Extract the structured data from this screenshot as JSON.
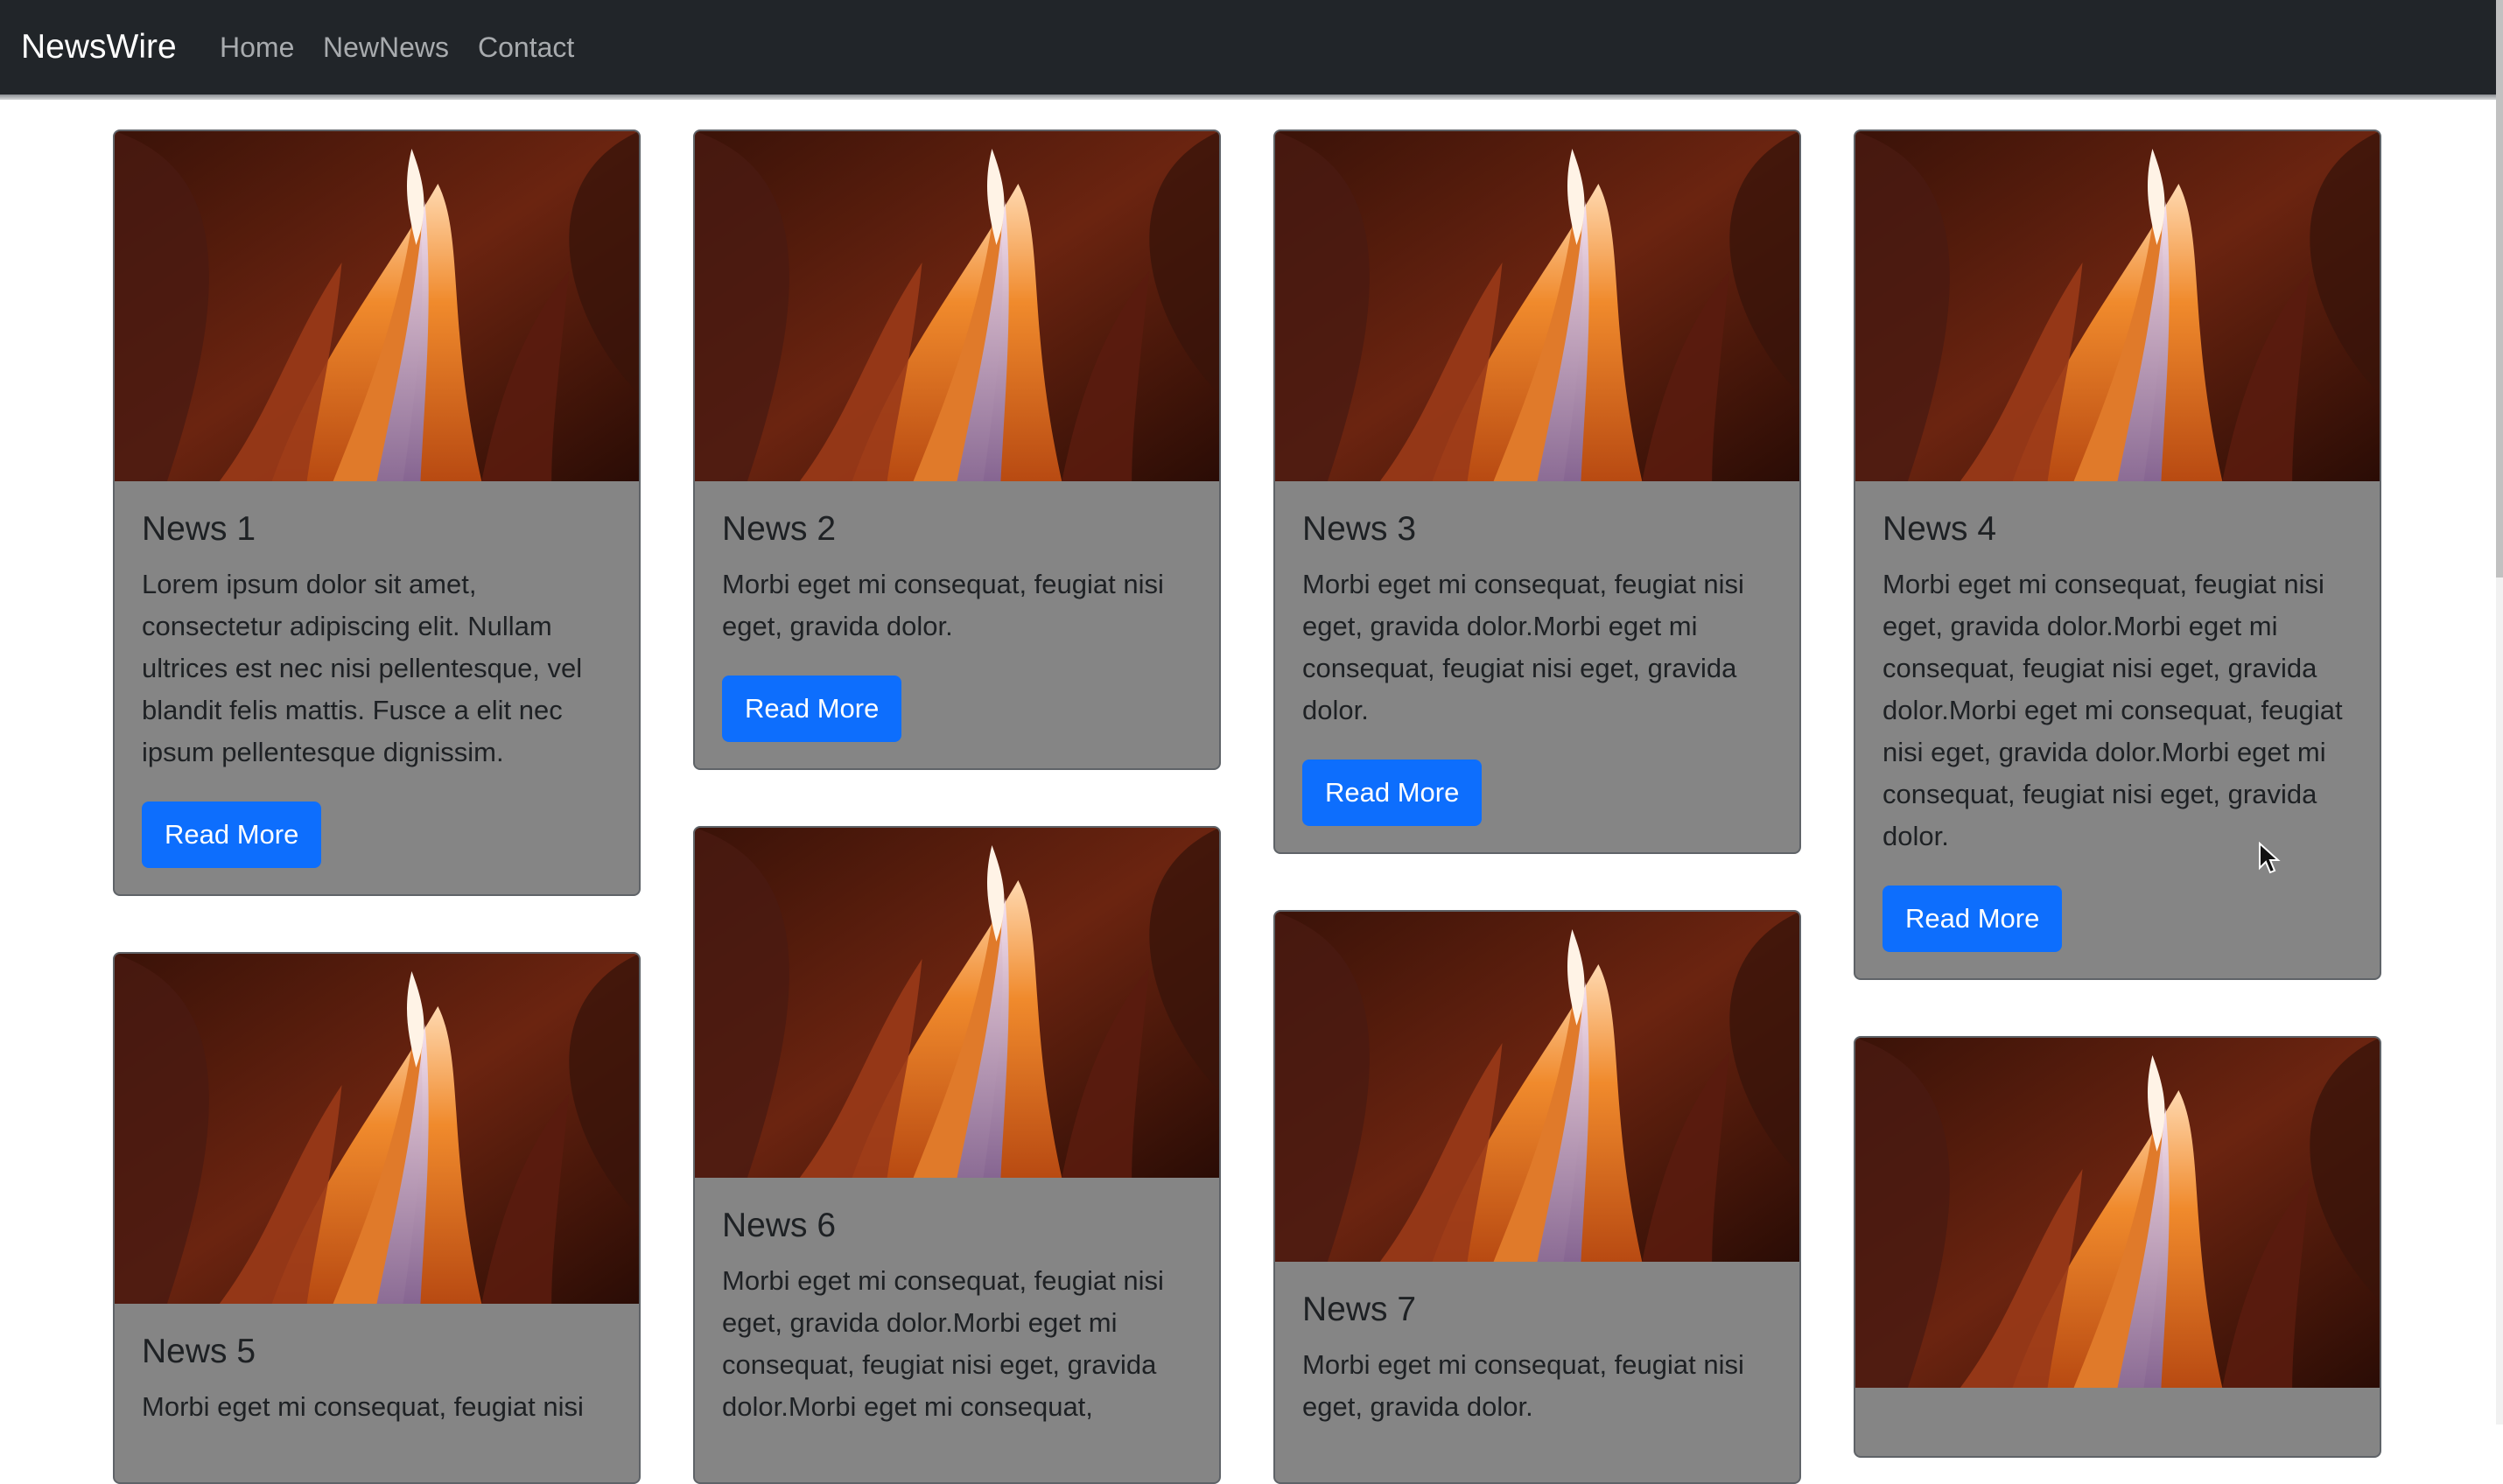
{
  "navbar": {
    "brand": "NewsWire",
    "links": [
      "Home",
      "NewNews",
      "Contact"
    ]
  },
  "cards": [
    {
      "title": "News 1",
      "text": "Lorem ipsum dolor sit amet, consectetur adipiscing elit. Nullam ultrices est nec nisi pellentesque, vel blandit felis mattis. Fusce a elit nec ipsum pellentesque dignissim.",
      "button": "Read More"
    },
    {
      "title": "News 2",
      "text": "Morbi eget mi consequat, feugiat nisi eget, gravida dolor.",
      "button": "Read More"
    },
    {
      "title": "News 3",
      "text": "Morbi eget mi consequat, feugiat nisi eget, gravida dolor.Morbi eget mi consequat, feugiat nisi eget, gravida dolor.",
      "button": "Read More"
    },
    {
      "title": "News 4",
      "text": "Morbi eget mi consequat, feugiat nisi eget, gravida dolor.Morbi eget mi consequat, feugiat nisi eget, gravida dolor.Morbi eget mi consequat, feugiat nisi eget, gravida dolor.Morbi eget mi consequat, feugiat nisi eget, gravida dolor.",
      "button": "Read More"
    },
    {
      "title": "News 5",
      "text": "Morbi eget mi consequat, feugiat nisi",
      "button": ""
    },
    {
      "title": "News 6",
      "text": "Morbi eget mi consequat, feugiat nisi eget, gravida dolor.Morbi eget mi consequat, feugiat nisi eget, gravida dolor.Morbi eget mi consequat,",
      "button": ""
    },
    {
      "title": "News 7",
      "text": "Morbi eget mi consequat, feugiat nisi eget, gravida dolor.",
      "button": ""
    },
    {
      "title": "",
      "text": "",
      "button": ""
    }
  ],
  "colors": {
    "navbar": "#212529",
    "card": "#858585",
    "button": "#0d6efd"
  }
}
